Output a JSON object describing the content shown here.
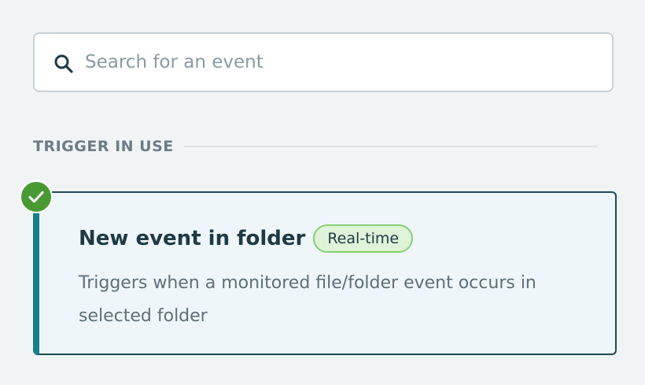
{
  "search": {
    "placeholder": "Search for an event",
    "value": "",
    "icon": "search-icon"
  },
  "section": {
    "heading": "TRIGGER IN USE"
  },
  "trigger": {
    "title": "New event in folder",
    "badge": "Real-time",
    "description": "Triggers when a monitored file/folder event occurs in selected folder",
    "selected_icon": "check-icon",
    "colors": {
      "accent": "#157f8a",
      "badge_border": "#86cf74",
      "badge_bg": "#dff3d8",
      "check_bg": "#4a9a34"
    }
  }
}
